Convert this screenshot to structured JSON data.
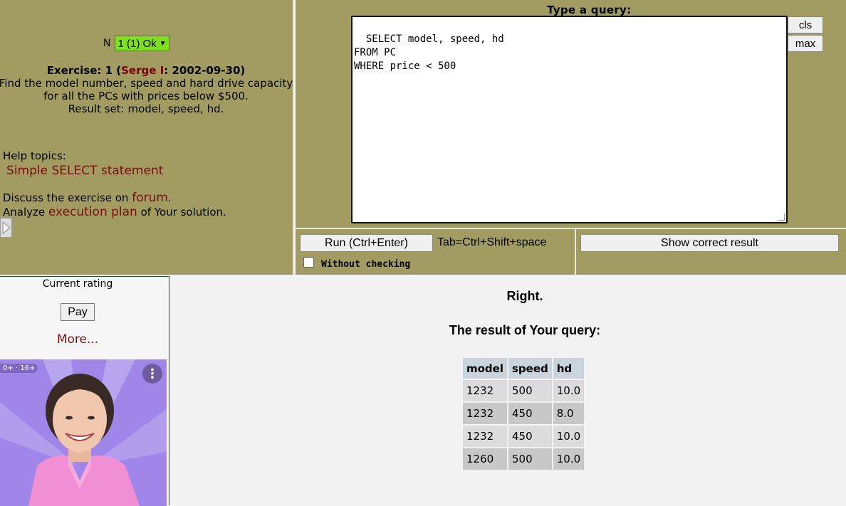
{
  "exercise_selector": {
    "prefix": "N",
    "selected": "1 (1) Ok"
  },
  "exercise": {
    "title_prefix": "Exercise: 1 (",
    "author": "Serge I",
    "title_suffix": ": 2002-09-30)",
    "lines": [
      "Find the model number, speed and hard drive capacity",
      "for all the PCs with prices below $500.",
      "Result set: model, speed, hd."
    ]
  },
  "help": {
    "label": "Help topics:",
    "topic": "Simple SELECT statement"
  },
  "discuss": {
    "prefix": "Discuss the exercise on ",
    "forum_link": "forum",
    "suffix": ".",
    "analyze_prefix": "Analyze ",
    "plan_link": "execution plan",
    "analyze_suffix": " of Your solution."
  },
  "query": {
    "label": "Type a query:",
    "text": "SELECT model, speed, hd\nFROM PC\nWHERE price < 500",
    "cls_label": "cls",
    "max_label": "max"
  },
  "controls": {
    "run_label": "Run (Ctrl+Enter)",
    "tab_hint": "Tab=Ctrl+Shift+space",
    "without_checking_label": "Without checking",
    "without_checking_checked": false,
    "show_correct_label": "Show correct result"
  },
  "rating": {
    "title": "Current rating",
    "pay_label": "Pay",
    "more_label": "More..."
  },
  "ad": {
    "badge": "0+ · 16+",
    "menu": "⋮"
  },
  "result": {
    "status": "Right.",
    "title": "The result of Your query:",
    "columns": [
      "model",
      "speed",
      "hd"
    ],
    "rows": [
      [
        "1232",
        "500",
        "10.0"
      ],
      [
        "1232",
        "450",
        "8.0"
      ],
      [
        "1232",
        "450",
        "10.0"
      ],
      [
        "1260",
        "500",
        "10.0"
      ]
    ]
  }
}
